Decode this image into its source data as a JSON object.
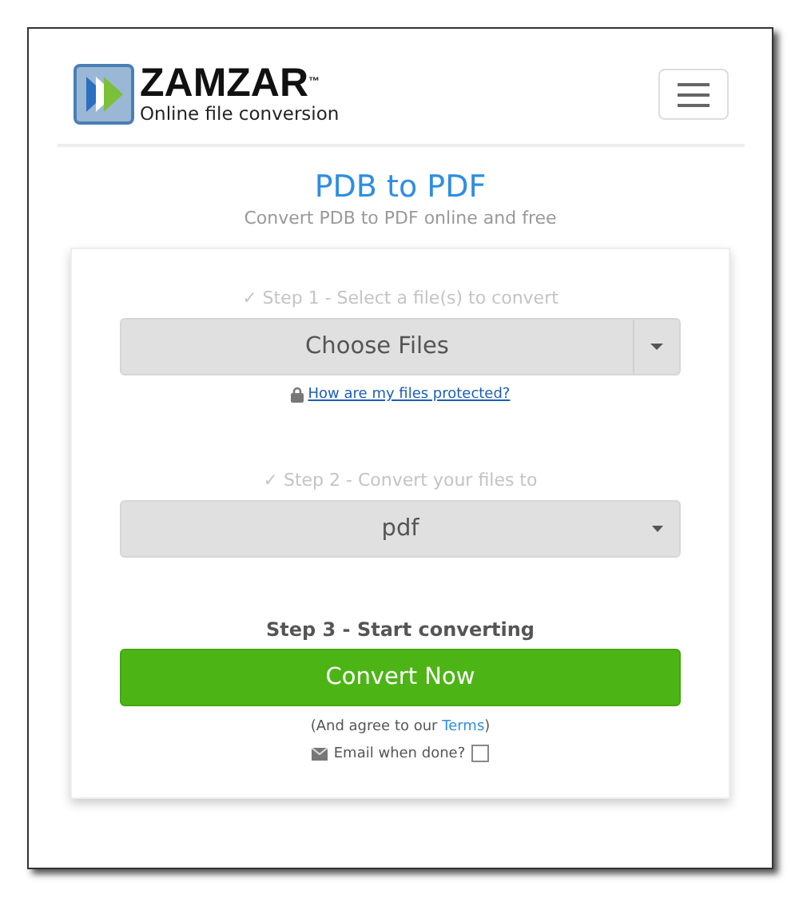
{
  "logo": {
    "name": "ZAMZAR",
    "trademark": "™",
    "tagline": "Online file conversion"
  },
  "title": "PDB to PDF",
  "subtitle": "Convert PDB to PDF online and free",
  "step1": {
    "label": "✓ Step 1 - Select a file(s) to convert",
    "button": "Choose Files",
    "link": "How are my files protected?"
  },
  "step2": {
    "label": "✓ Step 2 - Convert your files to",
    "value": "pdf"
  },
  "step3": {
    "label": "Step 3 - Start converting",
    "button": "Convert Now"
  },
  "terms": {
    "before": "(And agree to our ",
    "link": "Terms",
    "after": ")"
  },
  "email": {
    "label": "Email when done?",
    "checked": false
  }
}
